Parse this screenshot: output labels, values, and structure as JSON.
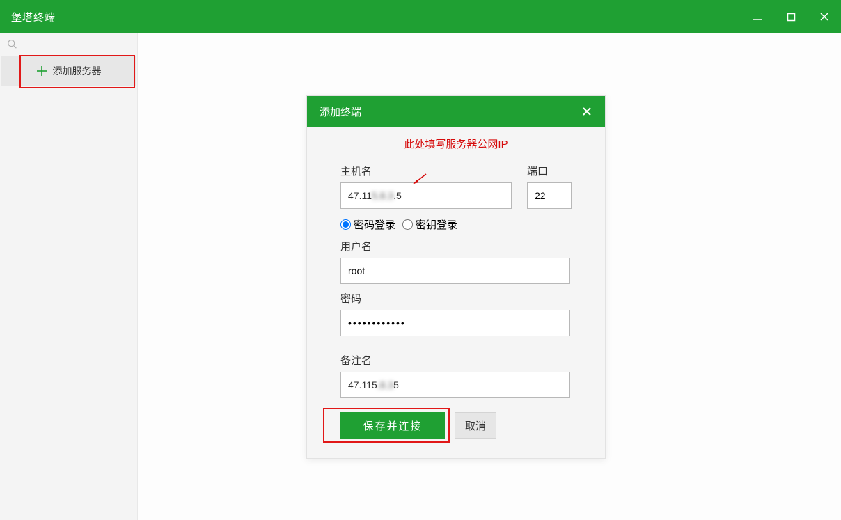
{
  "titlebar": {
    "title": "堡塔终端"
  },
  "sidebar": {
    "search_placeholder": "",
    "add_server_label": "添加服务器"
  },
  "modal": {
    "title": "添加终端",
    "tip": "此处填写服务器公网IP",
    "host_label": "主机名",
    "host_value_prefix": "47.11",
    "host_value_blurred": "5.8.3",
    "host_value_suffix": ".5",
    "port_label": "端口",
    "port_value": "22",
    "login_password_label": "密码登录",
    "login_key_label": "密钥登录",
    "username_label": "用户名",
    "username_value": "root",
    "password_label": "密码",
    "password_value": "••••••••••••",
    "remark_label": "备注名",
    "remark_value_prefix": "47.115",
    "remark_value_blurred": ".8.3",
    "remark_value_suffix": "5",
    "save_connect_label": "保存并连接",
    "cancel_label": "取消"
  },
  "colors": {
    "brand": "#1fa033",
    "danger": "#d60b0b"
  }
}
